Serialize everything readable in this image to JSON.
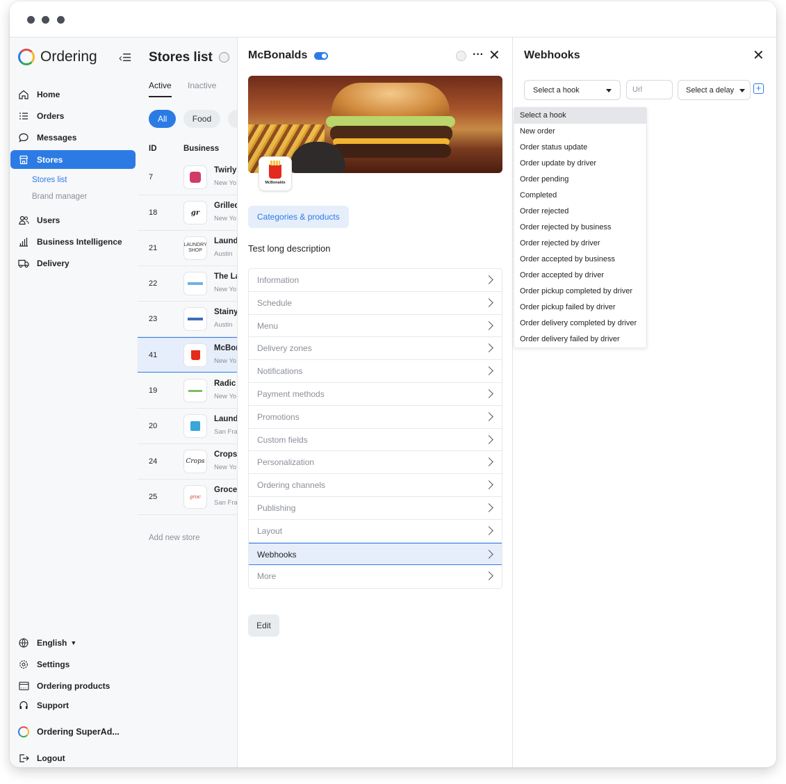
{
  "app": {
    "name": "Ordering"
  },
  "sidebar": {
    "items": [
      {
        "label": "Home",
        "icon": "home-icon"
      },
      {
        "label": "Orders",
        "icon": "list-icon"
      },
      {
        "label": "Messages",
        "icon": "chat-icon"
      },
      {
        "label": "Stores",
        "icon": "store-icon"
      },
      {
        "label": "Users",
        "icon": "users-icon"
      },
      {
        "label": "Business Intelligence",
        "icon": "chart-icon"
      },
      {
        "label": "Delivery",
        "icon": "truck-icon"
      }
    ],
    "sub_items": [
      "Stores list",
      "Brand manager"
    ],
    "bottom": {
      "language": "English",
      "settings": "Settings",
      "ordering_products": "Ordering products",
      "support": "Support",
      "account": "Ordering SuperAd...",
      "logout": "Logout"
    }
  },
  "stores_list": {
    "title": "Stores list",
    "tabs": [
      "Active",
      "Inactive"
    ],
    "chips": [
      "All",
      "Food",
      "G"
    ],
    "headers": {
      "id": "ID",
      "business": "Business"
    },
    "rows": [
      {
        "id": "7",
        "name": "Twirly",
        "city": "New Yo"
      },
      {
        "id": "18",
        "name": "Grilled",
        "city": "New Yo"
      },
      {
        "id": "21",
        "name": "Laund",
        "city": "Austin"
      },
      {
        "id": "22",
        "name": "The La",
        "city": "New Yo"
      },
      {
        "id": "23",
        "name": "Stainy",
        "city": "Austin"
      },
      {
        "id": "41",
        "name": "McBor",
        "city": "New Yo"
      },
      {
        "id": "19",
        "name": "Radic",
        "city": "New Yo"
      },
      {
        "id": "20",
        "name": "Laund",
        "city": "San Fra"
      },
      {
        "id": "24",
        "name": "Crops",
        "city": "New Yo"
      },
      {
        "id": "25",
        "name": "Groce",
        "city": "San Fra"
      }
    ],
    "add_new": "Add new store"
  },
  "store_detail": {
    "name": "McBonalds",
    "logo_caption": "McBonalds",
    "categories_button": "Categories & products",
    "description": "Test long description",
    "menu": [
      "Information",
      "Schedule",
      "Menu",
      "Delivery zones",
      "Notifications",
      "Payment methods",
      "Promotions",
      "Custom fields",
      "Personalization",
      "Ordering channels",
      "Publishing",
      "Layout",
      "Webhooks",
      "More"
    ],
    "selected_menu": "Webhooks",
    "edit_button": "Edit"
  },
  "webhooks": {
    "title": "Webhooks",
    "select_hook": "Select a hook",
    "url_placeholder": "Url",
    "select_delay": "Select a delay",
    "options": [
      "Select a hook",
      "New order",
      "Order status update",
      "Order update by driver",
      "Order pending",
      "Completed",
      "Order rejected",
      "Order rejected by business",
      "Order rejected by driver",
      "Order accepted by business",
      "Order accepted by driver",
      "Order pickup completed by driver",
      "Order pickup failed by driver",
      "Order delivery completed by driver",
      "Order delivery failed by driver"
    ]
  },
  "colors": {
    "accent": "#2c7be5",
    "selected_bg": "#e6eefb",
    "sidebar_bg": "#f7f8fa"
  }
}
